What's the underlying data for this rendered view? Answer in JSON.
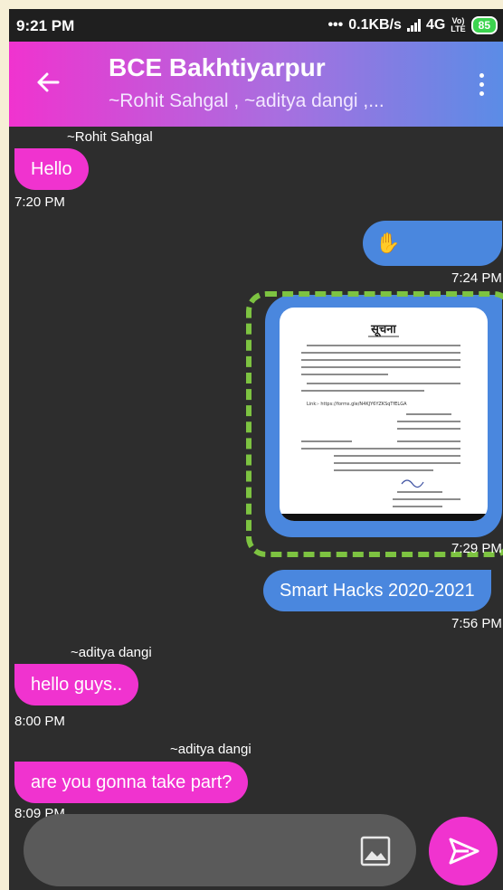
{
  "status": {
    "time": "9:21 PM",
    "dots": "•••",
    "speed": "0.1KB/s",
    "network": "4G",
    "volte_top": "Vo)",
    "volte_bottom": "LTE",
    "battery": "85"
  },
  "header": {
    "title": "BCE Bakhtiyarpur",
    "members": "~Rohit Sahgal , ~aditya dangi ,..."
  },
  "messages": {
    "m1": {
      "sender": "~Rohit Sahgal",
      "text": "Hello",
      "time": "7:20 PM"
    },
    "m2": {
      "emoji": "✋",
      "time": "7:24 PM"
    },
    "m3": {
      "time": "7:29 PM"
    },
    "m4": {
      "text": "Smart Hacks 2020-2021",
      "time": "7:56 PM"
    },
    "m5": {
      "sender": "~aditya dangi",
      "text": "hello guys..",
      "time": "8:00 PM"
    },
    "m6": {
      "sender": "~aditya dangi",
      "text": "are you gonna take part?",
      "time": "8:09 PM"
    }
  },
  "document": {
    "heading": "सूचना",
    "link": "Link:-  https://forms.gle/N4KJY6YZKSqTfELGA"
  },
  "input": {
    "placeholder": ""
  },
  "colors": {
    "accent": "#f033cf",
    "outgoing": "#4a87de",
    "highlight": "#7dc341"
  }
}
